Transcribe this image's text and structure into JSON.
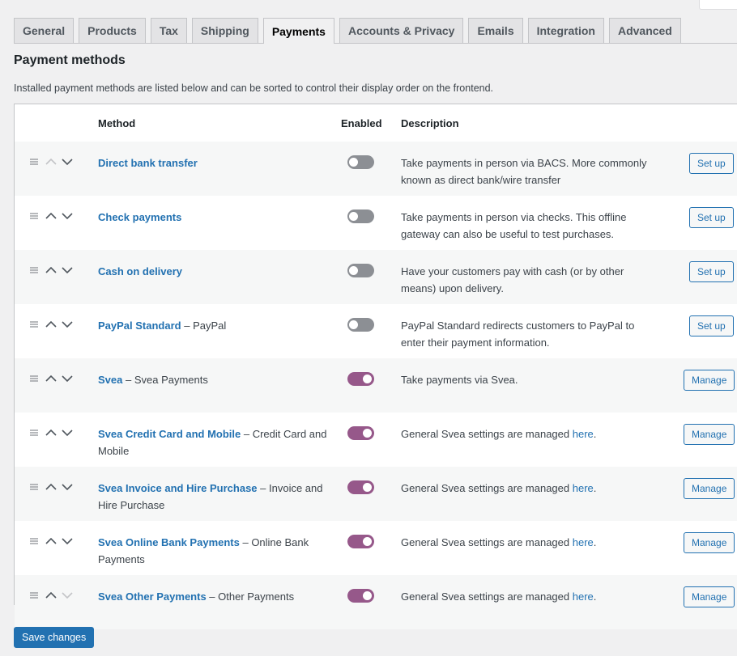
{
  "tabs": [
    {
      "label": "General",
      "active": false
    },
    {
      "label": "Products",
      "active": false
    },
    {
      "label": "Tax",
      "active": false
    },
    {
      "label": "Shipping",
      "active": false
    },
    {
      "label": "Payments",
      "active": true
    },
    {
      "label": "Accounts & Privacy",
      "active": false
    },
    {
      "label": "Emails",
      "active": false
    },
    {
      "label": "Integration",
      "active": false
    },
    {
      "label": "Advanced",
      "active": false
    }
  ],
  "section": {
    "title": "Payment methods",
    "description": "Installed payment methods are listed below and can be sorted to control their display order on the frontend."
  },
  "table": {
    "headers": {
      "method": "Method",
      "enabled": "Enabled",
      "description": "Description"
    },
    "rows": [
      {
        "name": "Direct bank transfer",
        "suffix": "",
        "enabled": false,
        "desc": "Take payments in person via BACS. More commonly known as direct bank/wire transfer",
        "desc_link": "",
        "desc_end": "",
        "button": "Set up",
        "up_disabled": true,
        "down_disabled": false
      },
      {
        "name": "Check payments",
        "suffix": "",
        "enabled": false,
        "desc": "Take payments in person via checks. This offline gateway can also be useful to test purchases.",
        "desc_link": "",
        "desc_end": "",
        "button": "Set up",
        "up_disabled": false,
        "down_disabled": false
      },
      {
        "name": "Cash on delivery",
        "suffix": "",
        "enabled": false,
        "desc": "Have your customers pay with cash (or by other means) upon delivery.",
        "desc_link": "",
        "desc_end": "",
        "button": "Set up",
        "up_disabled": false,
        "down_disabled": false
      },
      {
        "name": "PayPal Standard",
        "suffix": " – PayPal",
        "enabled": false,
        "desc": "PayPal Standard redirects customers to PayPal to enter their payment information.",
        "desc_link": "",
        "desc_end": "",
        "button": "Set up",
        "up_disabled": false,
        "down_disabled": false
      },
      {
        "name": "Svea",
        "suffix": " – Svea Payments",
        "enabled": true,
        "desc": "Take payments via Svea.",
        "desc_link": "",
        "desc_end": "",
        "button": "Manage",
        "up_disabled": false,
        "down_disabled": false
      },
      {
        "name": "Svea Credit Card and Mobile",
        "suffix": " – Credit Card and Mobile",
        "enabled": true,
        "desc": "General Svea settings are managed ",
        "desc_link": "here",
        "desc_end": ".",
        "button": "Manage",
        "up_disabled": false,
        "down_disabled": false
      },
      {
        "name": "Svea Invoice and Hire Purchase",
        "suffix": " – Invoice and Hire Purchase",
        "enabled": true,
        "desc": "General Svea settings are managed ",
        "desc_link": "here",
        "desc_end": ".",
        "button": "Manage",
        "up_disabled": false,
        "down_disabled": false
      },
      {
        "name": "Svea Online Bank Payments",
        "suffix": " – Online Bank Payments",
        "enabled": true,
        "desc": "General Svea settings are managed ",
        "desc_link": "here",
        "desc_end": ".",
        "button": "Manage",
        "up_disabled": false,
        "down_disabled": false
      },
      {
        "name": "Svea Other Payments",
        "suffix": " – Other Payments",
        "enabled": true,
        "desc": "General Svea settings are managed ",
        "desc_link": "here",
        "desc_end": ".",
        "button": "Manage",
        "up_disabled": false,
        "down_disabled": true
      }
    ]
  },
  "footer": {
    "save_label": "Save changes"
  },
  "colors": {
    "link": "#2271b1",
    "toggle_on": "#96588a",
    "toggle_off": "#8c8f94",
    "primary_button": "#2271b1"
  },
  "icons": {
    "drag": "drag-handle-icon",
    "up": "chevron-up-icon",
    "down": "chevron-down-icon"
  }
}
